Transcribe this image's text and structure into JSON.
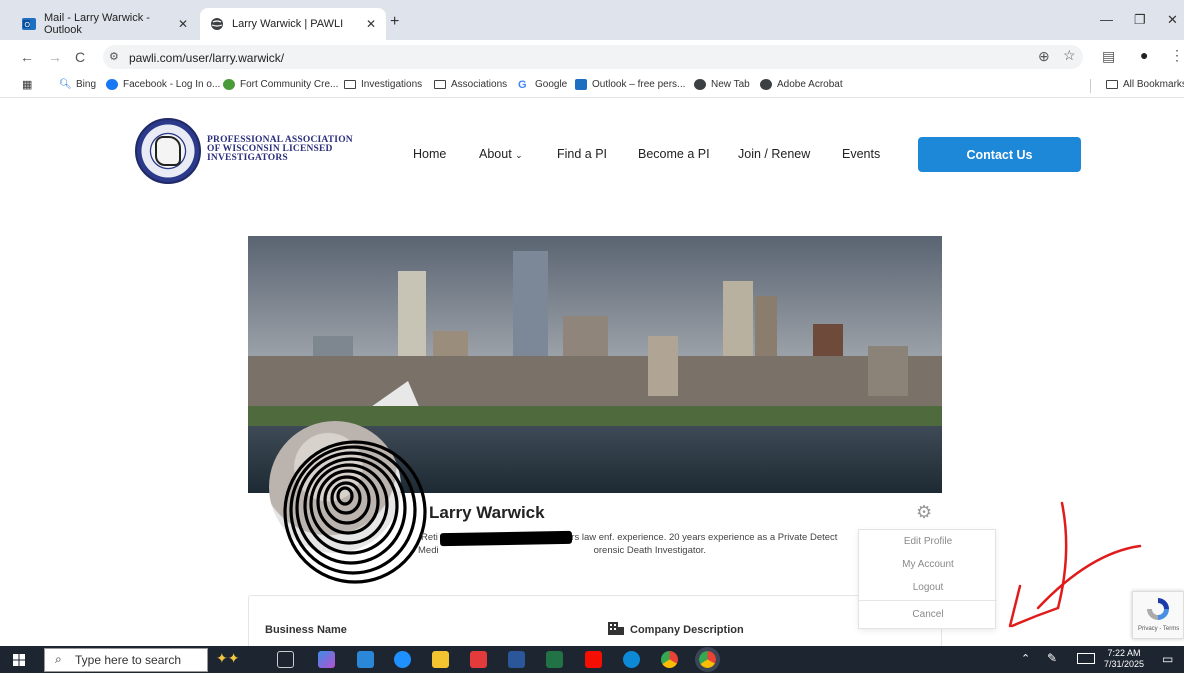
{
  "browser": {
    "tabs": [
      {
        "label": "Mail - Larry Warwick - Outlook",
        "active": false,
        "icon": "outlook-icon"
      },
      {
        "label": "Larry Warwick | PAWLI",
        "active": true,
        "icon": "globe-icon"
      }
    ],
    "url": "pawli.com/user/larry.warwick/",
    "bookmarks": [
      {
        "label": "Bing",
        "icon": "search-icon"
      },
      {
        "label": "Facebook - Log In o...",
        "icon": "facebook-icon"
      },
      {
        "label": "Fort Community Cre...",
        "icon": "fort-icon"
      },
      {
        "label": "Investigations",
        "icon": "folder-icon"
      },
      {
        "label": "Associations",
        "icon": "folder-icon"
      },
      {
        "label": "Google",
        "icon": "google-icon"
      },
      {
        "label": "Outlook – free pers...",
        "icon": "outlook-icon"
      },
      {
        "label": "New Tab",
        "icon": "globe-icon"
      },
      {
        "label": "Adobe Acrobat",
        "icon": "globe-icon"
      }
    ],
    "all_bookmarks": "All Bookmarks"
  },
  "site": {
    "logo_text": [
      "PROFESSIONAL ASSOCIATION",
      "OF WISCONSIN LICENSED",
      "INVESTIGATORS"
    ],
    "nav": [
      "Home",
      "About",
      "Find a PI",
      "Become a PI",
      "Join / Renew",
      "Events"
    ],
    "contact_button": "Contact Us",
    "accent_color": "#1e88d8"
  },
  "profile": {
    "name": "Larry Warwick",
    "bio_line1": "ars law enf. experience. 20 years experience as a Private Detect",
    "bio_line1_lead": "Reti",
    "bio_line2_lead": "Medi",
    "bio_line2": "orensic Death Investigator.",
    "menu": [
      "Edit Profile",
      "My Account",
      "Logout",
      "Cancel"
    ],
    "business_name_label": "Business Name",
    "company_description_label": "Company Description"
  },
  "taskbar": {
    "search_placeholder": "Type here to search",
    "time": "7:22 AM",
    "date": "7/31/2025"
  },
  "recaptcha": "Privacy - Terms"
}
